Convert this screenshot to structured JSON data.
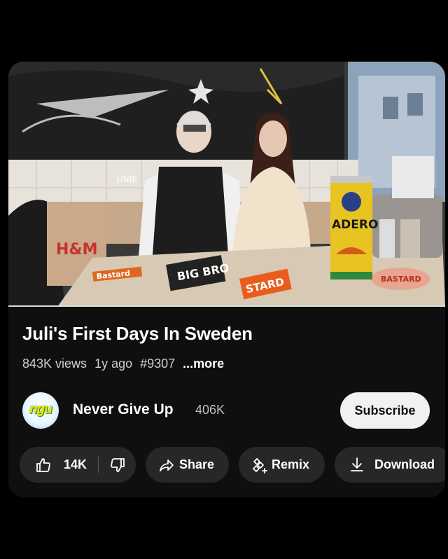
{
  "video": {
    "title": "Juli's First Days In Sweden",
    "views": "843K views",
    "age": "1y ago",
    "hashtag": "#9307",
    "more_label": "...more",
    "progress_fraction": 1.0
  },
  "thumbnail": {
    "can_text_top": "ADERO",
    "sign_text": "UNIE",
    "bag_text": "H&M",
    "sticker_texts": [
      "Bastard",
      "BIG BRO",
      "STARD",
      "BASTARD"
    ]
  },
  "channel": {
    "avatar_text": "ngu",
    "name": "Never Give Up",
    "subscribers": "406K",
    "subscribe_label": "Subscribe"
  },
  "actions": {
    "like_count": "14K",
    "share_label": "Share",
    "remix_label": "Remix",
    "download_label": "Download"
  },
  "colors": {
    "background": "#000000",
    "card": "#0f0f0f",
    "pill": "#272727",
    "subscribe_bg": "#f1f1f1"
  },
  "icons": [
    "thumbs-up-icon",
    "thumbs-down-icon",
    "share-arrow-icon",
    "remix-icon",
    "download-icon"
  ]
}
